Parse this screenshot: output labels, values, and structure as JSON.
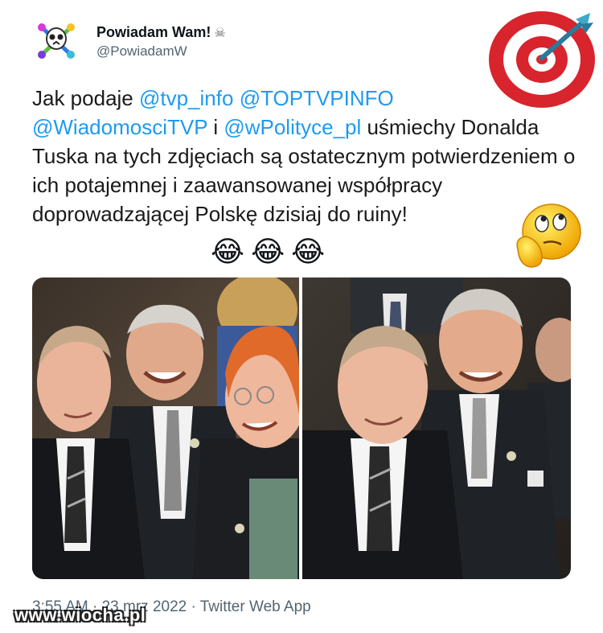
{
  "tweet": {
    "display_name": "Powiadam Wam!",
    "name_emoji": "☠",
    "handle": "@PowiadamW",
    "text_parts": {
      "p1": "Jak podaje ",
      "m1": "@tvp_info",
      "p2": " ",
      "m2": "@TOPTVPINFO",
      "p3": " ",
      "m3": "@WiadomosciTVP",
      "p4": " i ",
      "m4": "@wPolityce_pl",
      "p5": " uśmiechy Donalda Tuska na tych zdjęciach są ostatecznym potwierdzeniem o ich potajemnej i zaawansowanej współpracy doprowadzającej Polskę dzisiaj do ruiny!"
    },
    "emojis": "😂😂😂",
    "footer": "3:55 AM · 23 mrz 2022 · Twitter Web App"
  },
  "watermark": "www.wiocha.pl",
  "colors": {
    "mention": "#1d9bf0",
    "muted": "#536471",
    "target_red": "#d8242c"
  },
  "icons": {
    "avatar": "skull-crossbones-avatar",
    "target": "dartboard-icon",
    "thinker": "thinking-face-icon"
  }
}
